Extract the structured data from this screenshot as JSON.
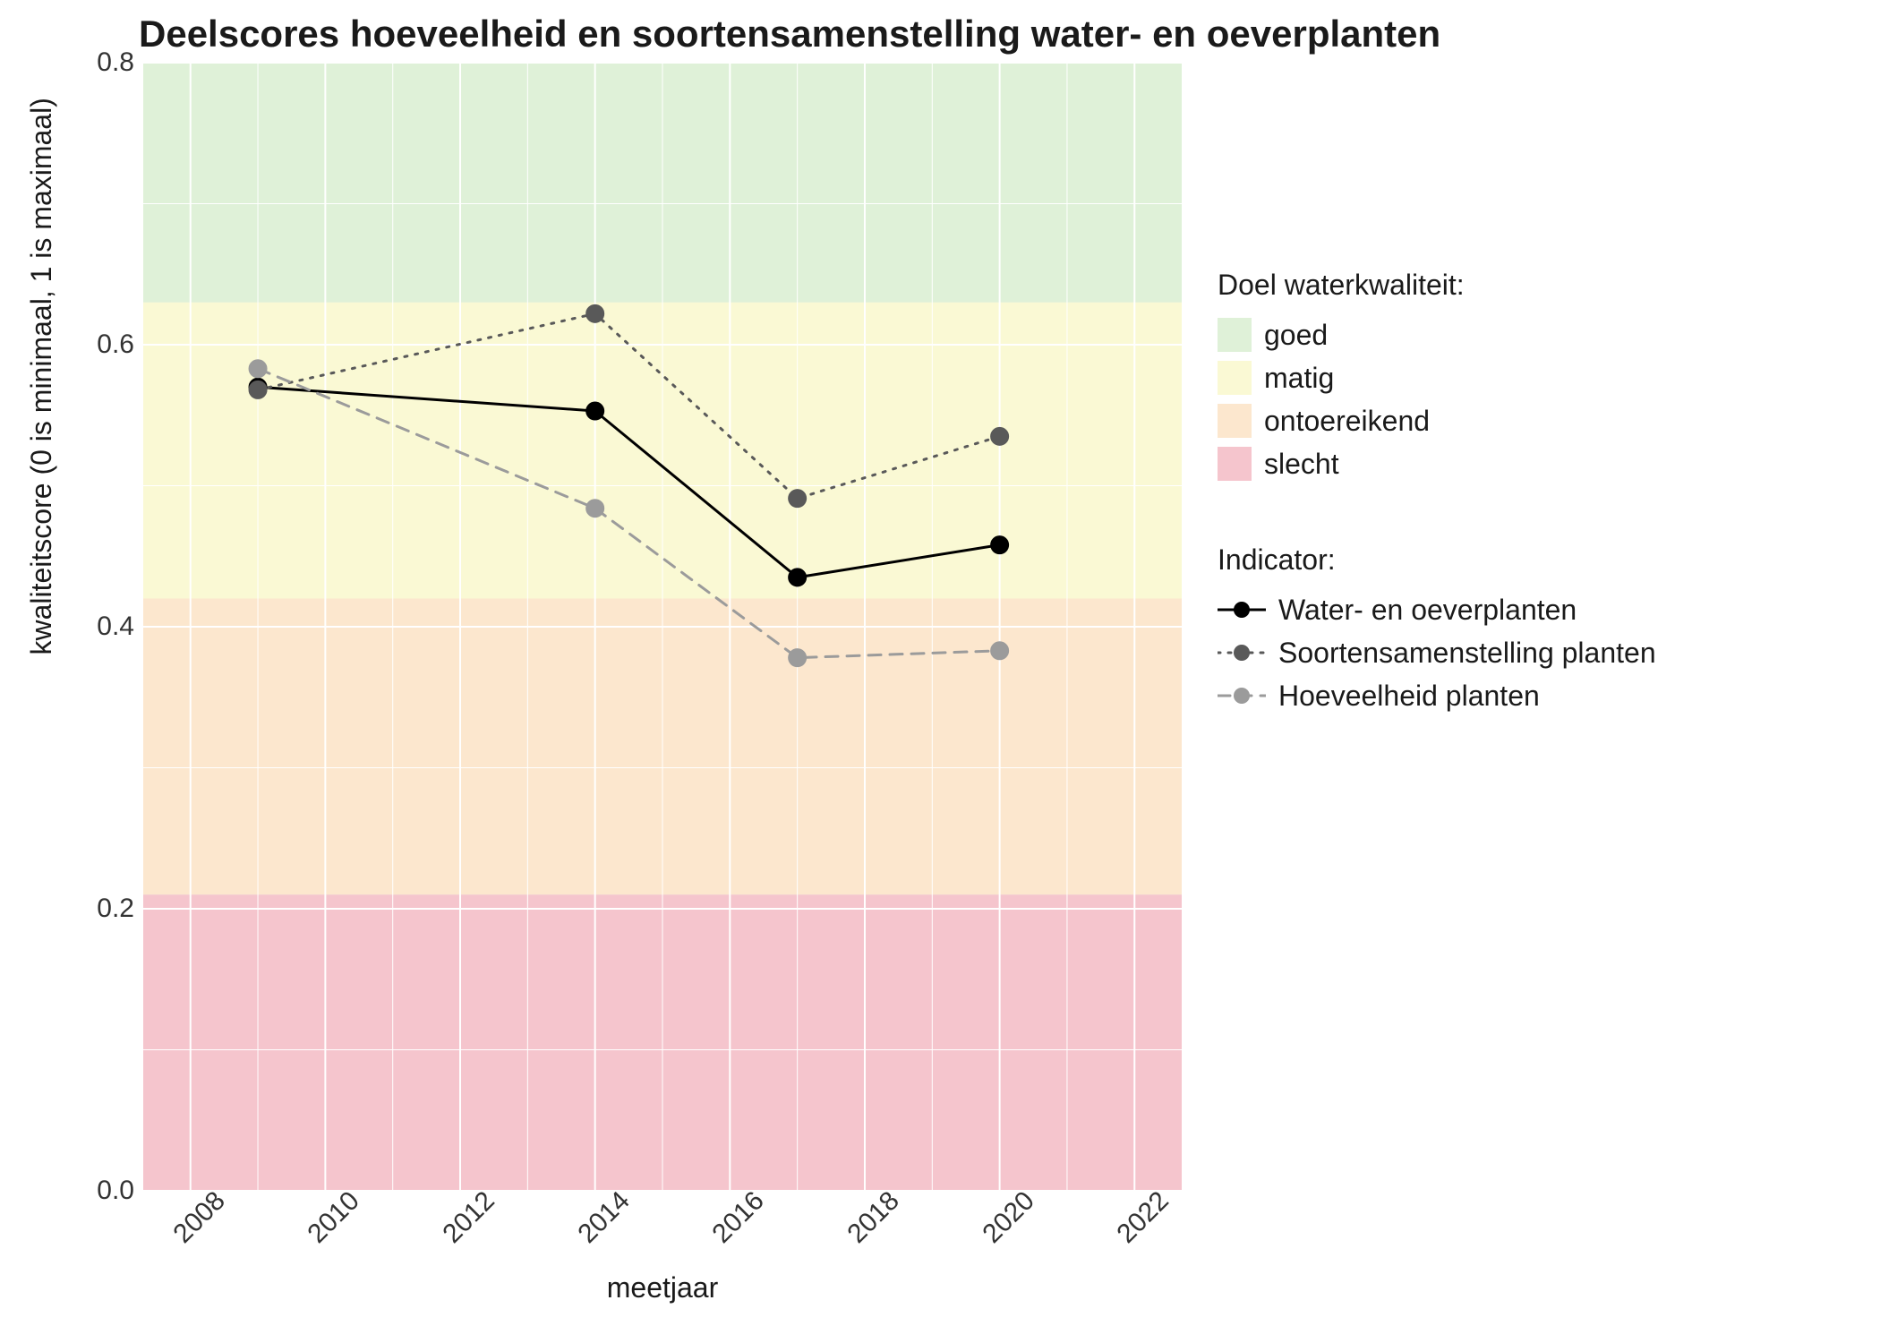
{
  "chart_data": {
    "type": "line",
    "title": "Deelscores hoeveelheid en soortensamenstelling water- en oeverplanten",
    "xlabel": "meetjaar",
    "ylabel": "kwaliteitscore (0 is minimaal, 1 is maximaal)",
    "xlim": [
      2007.3,
      2022.7
    ],
    "ylim": [
      0.0,
      0.8
    ],
    "x_ticks": [
      2008,
      2010,
      2012,
      2014,
      2016,
      2018,
      2020,
      2022
    ],
    "y_ticks": [
      0.0,
      0.2,
      0.4,
      0.6,
      0.8
    ],
    "x": [
      2009,
      2014,
      2017,
      2020
    ],
    "series": [
      {
        "name": "Water- en oeverplanten",
        "values": [
          0.57,
          0.553,
          0.435,
          0.458
        ],
        "color": "#000000",
        "dash": "solid",
        "point_color": "#000000"
      },
      {
        "name": "Soortensamenstelling planten",
        "values": [
          0.568,
          0.622,
          0.491,
          0.535
        ],
        "color": "#595959",
        "dash": "dotted",
        "point_color": "#595959"
      },
      {
        "name": "Hoeveelheid planten",
        "values": [
          0.583,
          0.484,
          0.378,
          0.383
        ],
        "color": "#9b9b9b",
        "dash": "dashed",
        "point_color": "#9b9b9b"
      }
    ],
    "background_bands": [
      {
        "name": "goed",
        "y0": 0.63,
        "y1": 0.8,
        "color": "#dff1d8"
      },
      {
        "name": "matig",
        "y0": 0.42,
        "y1": 0.63,
        "color": "#faf9d4"
      },
      {
        "name": "ontoereikend",
        "y0": 0.21,
        "y1": 0.42,
        "color": "#fce7ce"
      },
      {
        "name": "slecht",
        "y0": 0.0,
        "y1": 0.21,
        "color": "#f5c5cd"
      }
    ],
    "legend_band_title": "Doel waterkwaliteit:",
    "legend_series_title": "Indicator:"
  }
}
